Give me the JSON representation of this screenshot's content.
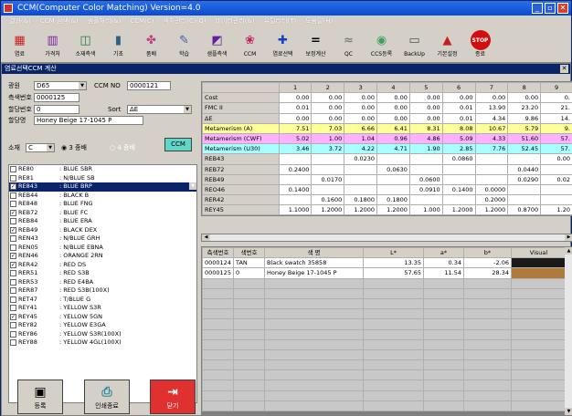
{
  "window": {
    "title": "CCM(Computer Color Matching) Version=4.0"
  },
  "menu": [
    "결과(&)",
    "CCM 검색(&)",
    "샘플처리(&)",
    "CCM(C)",
    "색차관리(C)(Q)",
    "데이터관리(&)",
    "유틸리티(T)",
    "도움말(H)"
  ],
  "toolbar": [
    {
      "label": "염료",
      "icon": "dye-icon",
      "glyph": "▦",
      "color": "#cc2020"
    },
    {
      "label": "가격처",
      "icon": "price-icon",
      "glyph": "▥",
      "color": "#8020a0"
    },
    {
      "label": "소재측색",
      "icon": "chart-icon",
      "glyph": "◫",
      "color": "#208040"
    },
    {
      "label": "기초",
      "icon": "bars-icon",
      "glyph": "▮",
      "color": "#306080"
    },
    {
      "label": "품배",
      "icon": "fabric-icon",
      "glyph": "✤",
      "color": "#c04080"
    },
    {
      "label": "학습",
      "icon": "learn-icon",
      "glyph": "✎",
      "color": "#4060a0"
    },
    {
      "label": "샘플측색",
      "icon": "sample-icon",
      "glyph": "◩",
      "color": "#6020a0"
    },
    {
      "label": "CCM",
      "icon": "ccm-icon",
      "glyph": "❀",
      "color": "#c02060"
    },
    {
      "label": "염료선택",
      "icon": "select-plus-icon",
      "glyph": "✚",
      "color": "#1040c0"
    },
    {
      "label": "보정계산",
      "icon": "equals-icon",
      "glyph": "=",
      "color": "#000000"
    },
    {
      "label": "QC",
      "icon": "qc-icon",
      "glyph": "≈",
      "color": "#808080"
    },
    {
      "label": "CCS등록",
      "icon": "disc-icon",
      "glyph": "◉",
      "color": "#40a060"
    },
    {
      "label": "BackUp",
      "icon": "backup-icon",
      "glyph": "▭",
      "color": "#505050"
    },
    {
      "label": "기본설정",
      "icon": "setting-icon",
      "glyph": "▲",
      "color": "#c02020"
    },
    {
      "label": "종료",
      "icon": "stop-icon",
      "glyph": "STOP",
      "color": "#d01010"
    }
  ],
  "subwindow": {
    "title": "염료선택CCM 계산"
  },
  "form": {
    "light_label": "광원",
    "light_value": "D65",
    "ccmno_label": "CCM NO",
    "ccmno_value": "0000121",
    "meas_label": "측색번호",
    "meas_value": "0000125",
    "reg_label": "할당번호",
    "reg_value": "0",
    "sort_label": "Sort",
    "sort_value": "ΔE",
    "name_label": "할당명",
    "name_value": "Honey Beige 17-1045 P",
    "mat_label": "소재",
    "mat_value": "C",
    "radio1": "3 종배",
    "radio2": "4 종배",
    "ccm_btn": "CCM"
  },
  "dyes": [
    {
      "checked": false,
      "code": "RE80",
      "name": ": BLUE SBR",
      "selected": false
    },
    {
      "checked": false,
      "code": "RE81",
      "name": ": N/BLUE SB",
      "selected": false
    },
    {
      "checked": true,
      "code": "RE843",
      "name": ": BLUE BRP",
      "selected": true
    },
    {
      "checked": false,
      "code": "REB44",
      "name": ": BLACK B",
      "selected": false
    },
    {
      "checked": false,
      "code": "RE848",
      "name": ": BLUE FNG",
      "selected": false
    },
    {
      "checked": true,
      "code": "REB72",
      "name": ": BLUE FC",
      "selected": false
    },
    {
      "checked": false,
      "code": "REB84",
      "name": ": BLUE ERA",
      "selected": false
    },
    {
      "checked": true,
      "code": "REB49",
      "name": ": BLACK DEX",
      "selected": false
    },
    {
      "checked": false,
      "code": "REN43",
      "name": ": N/BLUE GRH",
      "selected": false
    },
    {
      "checked": false,
      "code": "REN05",
      "name": ": N/BLUE EBNA",
      "selected": false
    },
    {
      "checked": true,
      "code": "REN46",
      "name": ": ORANGE 2RN",
      "selected": false
    },
    {
      "checked": true,
      "code": "RER42",
      "name": ": RED DS",
      "selected": false
    },
    {
      "checked": false,
      "code": "RER51",
      "name": ": RED S3B",
      "selected": false
    },
    {
      "checked": false,
      "code": "RER53",
      "name": ": RED E4BA",
      "selected": false
    },
    {
      "checked": false,
      "code": "RER87",
      "name": ": RED S3B(100X)",
      "selected": false
    },
    {
      "checked": false,
      "code": "RET47",
      "name": ": T/BLUE G",
      "selected": false
    },
    {
      "checked": false,
      "code": "REY41",
      "name": ": YELLOW S3R",
      "selected": false
    },
    {
      "checked": true,
      "code": "REY45",
      "name": ": YELLOW 5GN",
      "selected": false
    },
    {
      "checked": false,
      "code": "REY82",
      "name": ": YELLOW E3GA",
      "selected": false
    },
    {
      "checked": false,
      "code": "REY86",
      "name": ": YELLOW S3R(100X)",
      "selected": false
    },
    {
      "checked": false,
      "code": "REY88",
      "name": ": YELLOW 4GL(100X)",
      "selected": false
    }
  ],
  "buttons": {
    "save": "등록",
    "print": "인쇄종료",
    "close": "닫기"
  },
  "calc_table": {
    "columns": [
      "1",
      "2",
      "3",
      "4",
      "5",
      "6",
      "7",
      "8",
      "9"
    ],
    "rows": [
      {
        "label": "Cost",
        "bg": "#ffffff",
        "cells": [
          "0.00",
          "0.00",
          "0.00",
          "0.00",
          "0.00",
          "0.00",
          "0.00",
          "0.00",
          "0."
        ]
      },
      {
        "label": "FMC II",
        "bg": "#ffffff",
        "cells": [
          "0.01",
          "0.00",
          "0.00",
          "0.00",
          "0.00",
          "0.01",
          "13.90",
          "23.20",
          "21."
        ]
      },
      {
        "label": "ΔE",
        "bg": "#ffffff",
        "cells": [
          "0.00",
          "0.00",
          "0.00",
          "0.00",
          "0.00",
          "0.01",
          "4.34",
          "9.86",
          "14."
        ]
      },
      {
        "label": "Metamerism (A)",
        "bg": "#ffff99",
        "cells": [
          "7.51",
          "7.03",
          "6.66",
          "6.41",
          "8.31",
          "8.08",
          "10.67",
          "5.79",
          "9."
        ]
      },
      {
        "label": "Metamerism (CWF)",
        "bg": "#ffb0ff",
        "cells": [
          "5.02",
          "1.00",
          "1.04",
          "0.96",
          "4.86",
          "5.09",
          "4.33",
          "51.60",
          "57."
        ]
      },
      {
        "label": "Metamerism (U30)",
        "bg": "#a8ffff",
        "cells": [
          "3.46",
          "3.72",
          "4.22",
          "4.71",
          "1.90",
          "2.85",
          "7.76",
          "52.45",
          "57."
        ]
      },
      {
        "label": "REB43",
        "bg": "#ffffff",
        "cells": [
          "",
          "",
          "0.0230",
          "",
          "",
          "0.0860",
          "",
          "",
          "0.00"
        ]
      },
      {
        "label": "REB72",
        "bg": "#ffffff",
        "cells": [
          "0.2400",
          "",
          "",
          "0.0630",
          "",
          "",
          "",
          "0.0440",
          ""
        ]
      },
      {
        "label": "REB49",
        "bg": "#ffffff",
        "cells": [
          "",
          "0.0170",
          "",
          "",
          "0.0600",
          "",
          "",
          "0.0290",
          "0.02"
        ]
      },
      {
        "label": "REO46",
        "bg": "#ffffff",
        "cells": [
          "0.1400",
          "",
          "",
          "",
          "0.0910",
          "0.1400",
          "0.0000",
          "",
          ""
        ]
      },
      {
        "label": "RER42",
        "bg": "#ffffff",
        "cells": [
          "",
          "0.1600",
          "0.1800",
          "0.1800",
          "",
          "",
          "0.2000",
          "",
          ""
        ]
      },
      {
        "label": "REY45",
        "bg": "#ffffff",
        "cells": [
          "1.1000",
          "1.2000",
          "1.2000",
          "1.2000",
          "1.000",
          "1.2000",
          "1.2000",
          "0.8700",
          "1.20"
        ]
      }
    ]
  },
  "sample_table": {
    "columns": [
      "측색번호",
      "색번호",
      "색 명",
      "L*",
      "a*",
      "b*",
      "Visual"
    ],
    "rows": [
      {
        "meas": "0000124",
        "code": "TAN",
        "name": "Black swatch 35858",
        "L": "13.35",
        "a": "0.34",
        "b": "-2.06",
        "visual": "#1a1a1a"
      },
      {
        "meas": "0000125",
        "code": "0",
        "name": "Honey Beige 17-1045 P",
        "L": "57.65",
        "a": "11.54",
        "b": "28.34",
        "visual": "#b07a3a"
      }
    ]
  }
}
